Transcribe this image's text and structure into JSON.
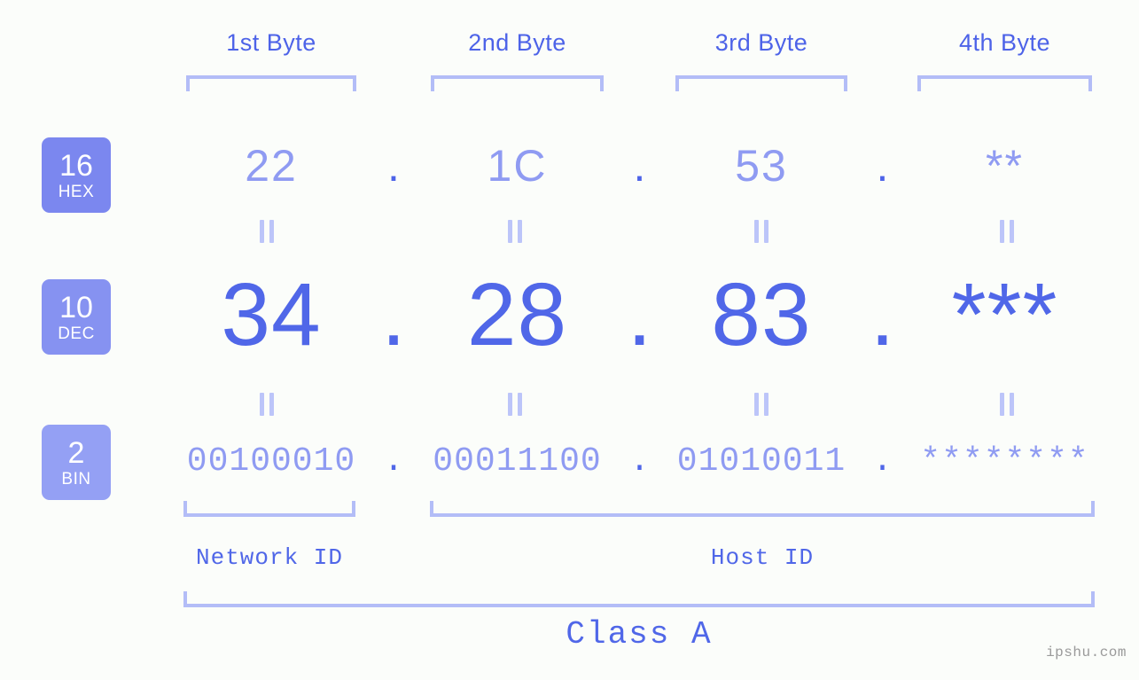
{
  "meta": {
    "background": "#fbfdfa",
    "accent_strong": "#5067e8",
    "accent_mid": "#8f9bf2",
    "accent_light": "#b3bdf7",
    "watermark": "ipshu.com"
  },
  "byte_headers": [
    {
      "label": "1st Byte"
    },
    {
      "label": "2nd Byte"
    },
    {
      "label": "3rd Byte"
    },
    {
      "label": "4th Byte"
    }
  ],
  "bases": [
    {
      "number": "16",
      "abbr": "HEX",
      "color": "#7b87ef"
    },
    {
      "number": "10",
      "abbr": "DEC",
      "color": "#8692f1"
    },
    {
      "number": "2",
      "abbr": "BIN",
      "color": "#94a0f4"
    }
  ],
  "rows": {
    "hex": {
      "base_number": "16",
      "base_abbr": "HEX",
      "values": [
        "22",
        "1C",
        "53",
        "**"
      ],
      "separator": "."
    },
    "dec": {
      "base_number": "10",
      "base_abbr": "DEC",
      "values": [
        "34",
        "28",
        "83",
        "***"
      ],
      "separator": "."
    },
    "bin": {
      "base_number": "2",
      "base_abbr": "BIN",
      "values": [
        "00100010",
        "00011100",
        "01010011",
        "********"
      ],
      "separator": "."
    }
  },
  "equals_marker": "=",
  "sections": {
    "network_id": "Network ID",
    "host_id": "Host ID",
    "class": "Class A"
  }
}
